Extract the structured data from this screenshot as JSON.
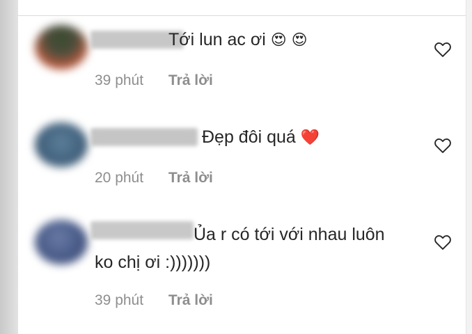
{
  "comments": [
    {
      "text": "Tới lun ac ơi",
      "emojis": [
        "😍",
        "😍"
      ],
      "time": "39 phút",
      "reply_label": "Trả lời",
      "avatar_colors": [
        "#3c4b2f",
        "#b85a3e"
      ],
      "name_color": "#c7c7c7"
    },
    {
      "text": "Đẹp đôi quá",
      "emojis": [
        "❤️"
      ],
      "time": "20 phút",
      "reply_label": "Trả lời",
      "avatar_colors": [
        "#5e7f98",
        "#2f4860"
      ],
      "name_color": "#c5c5c5"
    },
    {
      "text_line1": "Ủa r có tới với nhau luôn",
      "text_line2": "ko chị ơi :)))))))",
      "time": "39 phút",
      "reply_label": "Trả lời",
      "avatar_colors": [
        "#6a7ba6",
        "#33426d"
      ],
      "name_color": "#c8c8c8"
    }
  ],
  "icons": {
    "like": "heart-outline-icon"
  },
  "colors": {
    "text": "#262626",
    "meta": "#8e8e8e",
    "divider": "#dbdbdb"
  }
}
